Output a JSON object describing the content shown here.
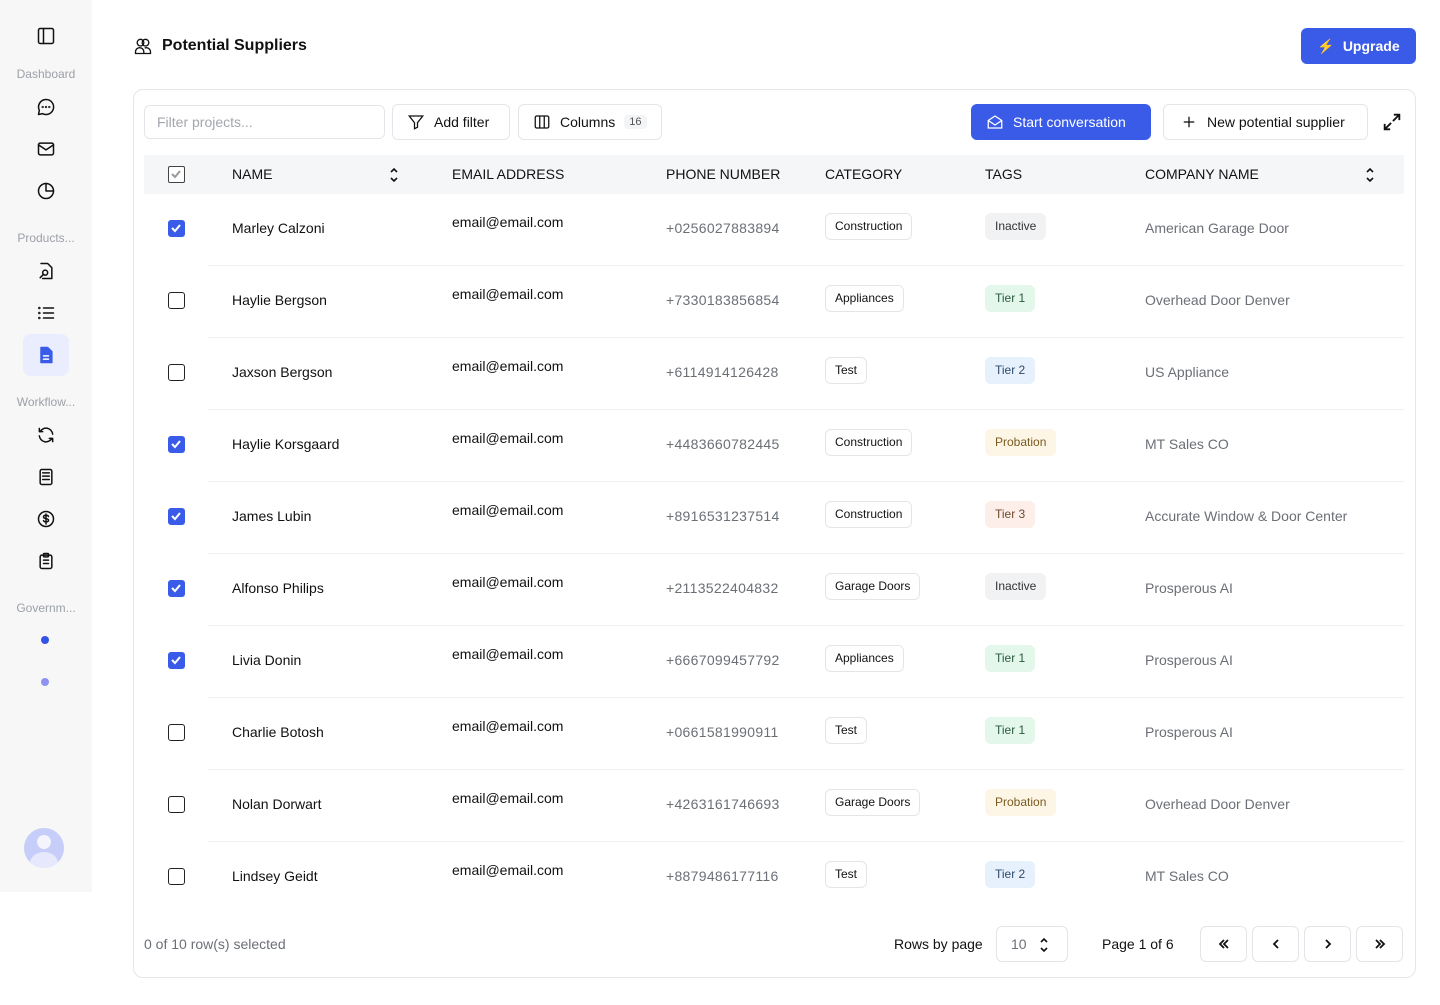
{
  "sidebar": {
    "sections": [
      {
        "label": "Dashboard"
      },
      {
        "label": "Products..."
      },
      {
        "label": "Workflow..."
      },
      {
        "label": "Governm..."
      }
    ],
    "colors": {
      "active": "#3a5be8",
      "dot1": "#3352e6",
      "dot2": "#8e92f0"
    }
  },
  "header": {
    "title": "Potential Suppliers",
    "upgrade_label": "Upgrade"
  },
  "toolbar": {
    "filter_placeholder": "Filter projects...",
    "add_filter_label": "Add filter",
    "columns_label": "Columns",
    "columns_count": "16",
    "start_conversation_label": "Start conversation",
    "new_supplier_label": "New potential supplier"
  },
  "table": {
    "columns": [
      "NAME",
      "EMAIL ADDRESS",
      "PHONE NUMBER",
      "CATEGORY",
      "TAGS",
      "COMPANY NAME"
    ],
    "tag_colors": {
      "Inactive": {
        "bg": "#f1f2f4",
        "fg": "#333"
      },
      "Tier 1": {
        "bg": "#e3f8ea",
        "fg": "#2a5a3a"
      },
      "Tier 2": {
        "bg": "#e6f1fd",
        "fg": "#2f4a6a"
      },
      "Tier 3": {
        "bg": "#fdeeea",
        "fg": "#6b4a2a"
      },
      "Probation": {
        "bg": "#fdf6e6",
        "fg": "#7a5a20"
      }
    },
    "rows": [
      {
        "checked": true,
        "name": "Marley Calzoni",
        "email": "email@email.com",
        "phone": "+0256027883894",
        "category": "Construction",
        "tag": "Inactive",
        "company": "American Garage Door"
      },
      {
        "checked": false,
        "name": "Haylie Bergson",
        "email": "email@email.com",
        "phone": "+7330183856854",
        "category": "Appliances",
        "tag": "Tier 1",
        "company": "Overhead Door Denver"
      },
      {
        "checked": false,
        "name": "Jaxson Bergson",
        "email": "email@email.com",
        "phone": "+6114914126428",
        "category": "Test",
        "tag": "Tier 2",
        "company": "US Appliance"
      },
      {
        "checked": true,
        "name": "Haylie Korsgaard",
        "email": "email@email.com",
        "phone": "+4483660782445",
        "category": "Construction",
        "tag": "Probation",
        "company": "MT Sales CO"
      },
      {
        "checked": true,
        "name": "James Lubin",
        "email": "email@email.com",
        "phone": "+8916531237514",
        "category": "Construction",
        "tag": "Tier 3",
        "company": "Accurate Window & Door Center"
      },
      {
        "checked": true,
        "name": "Alfonso Philips",
        "email": "email@email.com",
        "phone": "+2113522404832",
        "category": "Garage Doors",
        "tag": "Inactive",
        "company": "Prosperous AI"
      },
      {
        "checked": true,
        "name": "Livia Donin",
        "email": "email@email.com",
        "phone": "+6667099457792",
        "category": "Appliances",
        "tag": "Tier 1",
        "company": "Prosperous AI"
      },
      {
        "checked": false,
        "name": "Charlie Botosh",
        "email": "email@email.com",
        "phone": "+0661581990911",
        "category": "Test",
        "tag": "Tier 1",
        "company": "Prosperous AI"
      },
      {
        "checked": false,
        "name": "Nolan Dorwart",
        "email": "email@email.com",
        "phone": "+4263161746693",
        "category": "Garage Doors",
        "tag": "Probation",
        "company": "Overhead Door Denver"
      },
      {
        "checked": false,
        "name": "Lindsey Geidt",
        "email": "email@email.com",
        "phone": "+8879486177116",
        "category": "Test",
        "tag": "Tier 2",
        "company": "MT Sales CO"
      }
    ]
  },
  "footer": {
    "selection_text": "0 of 10 row(s) selected",
    "rows_by_page_label": "Rows by page",
    "rows_by_page_value": "10",
    "page_text": "Page 1 of 6"
  }
}
